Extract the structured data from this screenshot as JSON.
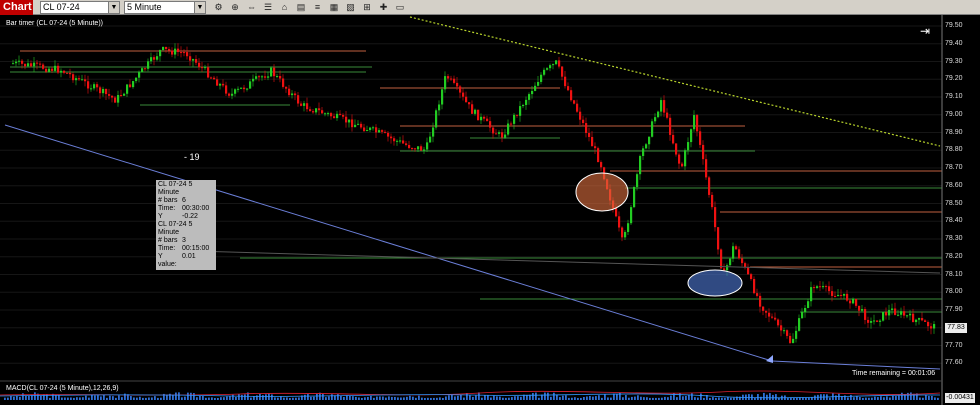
{
  "toolbar": {
    "tab_label": "Chart",
    "instrument": "CL 07-24",
    "interval": "5 Minute",
    "buttons": [
      "⚙",
      "⊕",
      "⇔",
      "☰",
      "⌂",
      "▤",
      "≡",
      "▦",
      "▧",
      "⊞",
      "✚",
      "▭"
    ]
  },
  "chart": {
    "header": "Bar timer (CL 07-24 (5 Minute))",
    "count_label": "- 19",
    "time_remaining": "Time remaining = 00:01:06",
    "last_price": "77.83",
    "price_axis": [
      "79.50",
      "79.40",
      "79.30",
      "79.20",
      "79.10",
      "79.00",
      "78.90",
      "78.80",
      "78.70",
      "78.60",
      "78.50",
      "78.40",
      "78.30",
      "78.20",
      "78.10",
      "78.00",
      "77.90",
      "77.80",
      "77.70",
      "77.60"
    ],
    "info_boxes": [
      {
        "title": "CL 07-24 5 Minute",
        "bars": "6",
        "time": "00:30:00",
        "yvalue": "-0.22"
      },
      {
        "title": "CL 07-24 5 Minute",
        "bars": "3",
        "time": "00:15:00",
        "yvalue": "0.01"
      }
    ],
    "info_keys": {
      "bars": "# bars",
      "time": "Time:",
      "yvalue": "Y value:"
    },
    "colors": {
      "up": "#22cc22",
      "down": "#ee1111",
      "trend": "#b8d42c",
      "regression": "#6b7fd8"
    }
  },
  "macd": {
    "label": "MACD(CL 07-24 (5 Minute),12,26,9)",
    "value": "-0.00431"
  }
}
